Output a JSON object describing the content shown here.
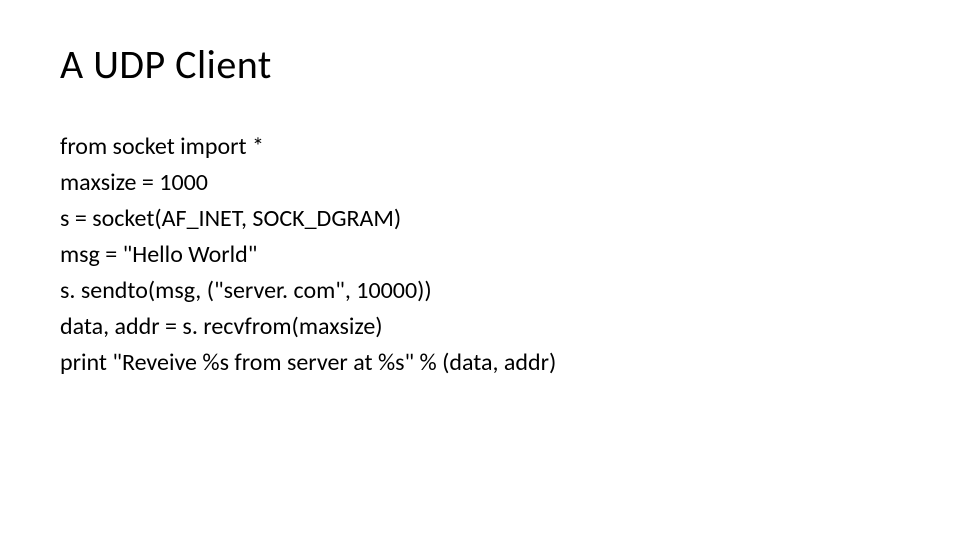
{
  "slide": {
    "title": "A UDP Client",
    "code": {
      "line1": "from socket import *",
      "line2": "maxsize = 1000",
      "line3": "s = socket(AF_INET, SOCK_DGRAM)",
      "line4": "msg = \"Hello World\"",
      "line5": "s. sendto(msg, (\"server. com\", 10000))",
      "line6": "data, addr = s. recvfrom(maxsize)",
      "line7": "print \"Reveive %s from server at %s\" % (data, addr)"
    }
  }
}
